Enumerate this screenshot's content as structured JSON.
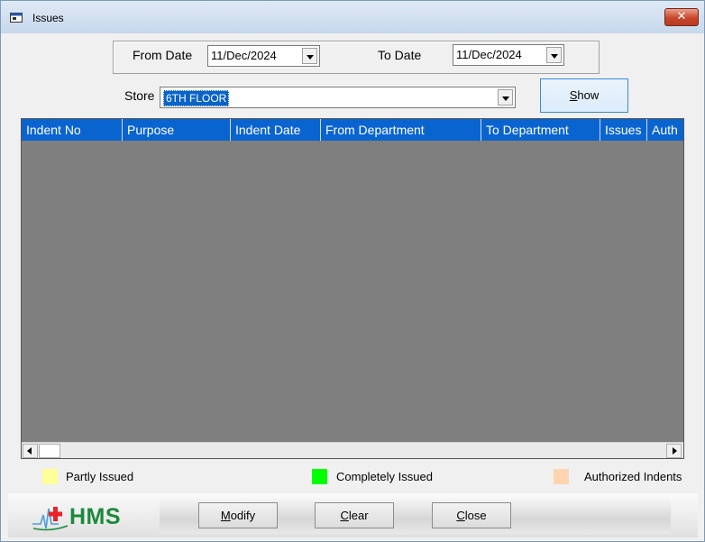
{
  "window": {
    "title": "Issues",
    "close_glyph": "✕"
  },
  "filters": {
    "from_date_label": "From Date",
    "from_date_value": "11/Dec/2024",
    "to_date_label": "To Date",
    "to_date_value": "11/Dec/2024",
    "store_label": "Store",
    "store_value": "6TH FLOOR",
    "show_button": {
      "mnemonic": "S",
      "rest": "how"
    }
  },
  "grid": {
    "columns": [
      "Indent No",
      "Purpose",
      "Indent Date",
      "From Department",
      "To Department",
      "Issues",
      "Auth"
    ],
    "rows": []
  },
  "legend": [
    {
      "label": "Partly Issued",
      "color": "#ffff99"
    },
    {
      "label": "Completely Issued",
      "color": "#00ff00"
    },
    {
      "label": "Authorized Indents",
      "color": "#fcd5b0"
    }
  ],
  "actions": {
    "modify": {
      "mnemonic": "M",
      "rest": "odify"
    },
    "clear": {
      "mnemonic": "C",
      "rest": "lear"
    },
    "close": {
      "mnemonic": "C",
      "rest": "lose"
    }
  },
  "brand": {
    "logo_text": "HMS",
    "icon": "hospital-cross-logo",
    "accent": "#e8232a"
  }
}
